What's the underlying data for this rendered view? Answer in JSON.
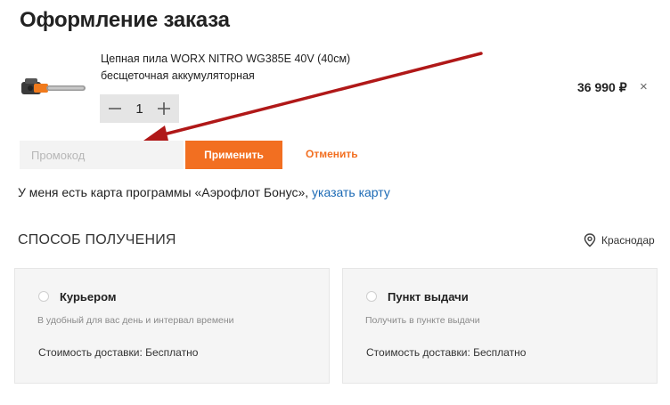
{
  "page": {
    "title": "Оформление заказа"
  },
  "cart": {
    "item": {
      "image": "chainsaw-image",
      "name": "Цепная пила WORX NITRO WG385E 40V (40см) бесщеточная аккумуляторная",
      "quantity": "1",
      "price": "36 990 ₽",
      "remove_icon": "×"
    }
  },
  "promo": {
    "placeholder": "Промокод",
    "apply_label": "Применить",
    "cancel_label": "Отменить"
  },
  "bonus": {
    "text": "У меня есть карта программы «Аэрофлот Бонус», ",
    "link": "указать карту"
  },
  "delivery": {
    "title": "СПОСОБ ПОЛУЧЕНИЯ",
    "city": "Краснодар",
    "options": [
      {
        "title": "Курьером",
        "subtitle": "В удобный для вас день и интервал времени",
        "cost": "Стоимость доставки: Бесплатно"
      },
      {
        "title": "Пункт выдачи",
        "subtitle": "Получить в пункте выдачи",
        "cost": "Стоимость доставки: Бесплатно"
      }
    ]
  },
  "colors": {
    "accent": "#f26f21",
    "link": "#1c6ab5",
    "annotation_arrow": "#b01818"
  }
}
